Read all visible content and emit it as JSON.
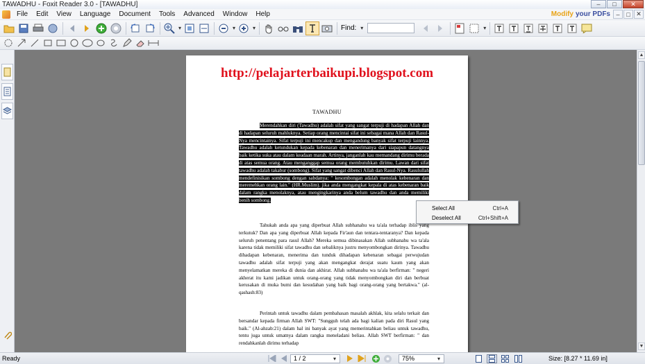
{
  "window": {
    "title": "TAWADHU - Foxit Reader 3.0 - [TAWADHU]",
    "minimize": "–",
    "maximize": "□",
    "close": "✕"
  },
  "menu": {
    "items": [
      "File",
      "Edit",
      "View",
      "Language",
      "Document",
      "Tools",
      "Advanced",
      "Window",
      "Help"
    ],
    "promo_1": "Modify",
    "promo_2": "your PDFs"
  },
  "toolbar": {
    "find_label": "Find:",
    "find_value": ""
  },
  "document": {
    "url": "http://pelajarterbaikupi.blogspot.com",
    "heading": "TAWADHU",
    "para1": "Merendahkan diri (Tawadhu) adalah sifat yang sangat terpuji di hadapan Allah dan di hadapan seluruh mahluknya. Setiap orang mencintai sifat ini sebagai mana Allah dan Rasul-Nya mencintainya. Sifat terpuji ini mencakup dan mengandung banyak sifat terpuji lainnya. Tawadhu adalah ketundukan kepada kebenaran dan menerimanya dari siapapun datangnya baik ketika suka atau dalam keadaan marah. Artinya, janganlah kau memandang dirimu berada di atas semua orang. Atau menganggap semua orang membutuhkan dirimu. Lawan dari sifat tawadhu adalah takabur (sombong). Sifat yang sangat dibenci Allah dan Rasul-Nya. Rasulullah mendefinisikan sombong dengan sabdanya: \" kesombongan adalah menolak kebenaran dan meremehkan orang lain.\" (HR.Muslim). jika anda mengangkat kepala di atas kebenaran baik dalam rangka menolaknya, atau mengingkarinya anda belum tawadhu dan anda memiliki benih sombong.",
    "para2": "Tahukah anda apa yang diperbuat Allah subhanahu wa ta'ala terhadap iblis yang terkutuk? Dan apa yang diperbuat Allah kepada Fir'aun dan tentara-tentaranya? Dan kepada seluruh penentang para rasul Allah? Mereka semua dibinasakan Allah subhanahu wa ta'ala karena tidak memiliki sifat tawadhu dan sebaliknya justru menyombongkan dirinya. Tawadhu dihadapan kebenaran, menerima dan tunduk dihadapan kebenaran sebagai perwujudan tawadhu adalah sifat terpuji yang akan mengangkat derajat suatu kaum yang akan menyelamatkan mereka di dunia dan akhirat. Allah subhanahu wa ta'ala berfirman: \" negeri akherat itu kami jadikan untuk orang-orang yang tidak menyombongkan diri dan berbuat kerusakan di muka bumi dan kesudahan yang baik bagi orang-orang yang bertakwa.\" (al-qashash:83)",
    "para3": "Perintah untuk tawadhu dalam pembahasan masalah akhlak, kita selalu terkait dan bersandar kepada firman Allah SWT: \"Sungguh telah ada bagi kalian pada diri Rasul yang baik.\" (Al-ahzab:21) dalam hal ini banyak ayat yang memerintahkan beliau untuk tawadhu, tentu juga untuk umatnya dalam rangka meneladani beliau. Allah SWT berfirman: \" dan rendahkanlah dirimu terhadap"
  },
  "context_menu": {
    "items": [
      {
        "label": "Select All",
        "shortcut": "Ctrl+A"
      },
      {
        "label": "Deselect All",
        "shortcut": "Ctrl+Shift+A"
      }
    ]
  },
  "status": {
    "ready": "Ready",
    "page": "1 / 2",
    "zoom": "75%",
    "size": "Size: [8.27 * 11.69 in]"
  },
  "colors": {
    "url_red": "#e0101c",
    "highlight": "#0a0a0a",
    "doc_background": "#7a7a7a"
  }
}
